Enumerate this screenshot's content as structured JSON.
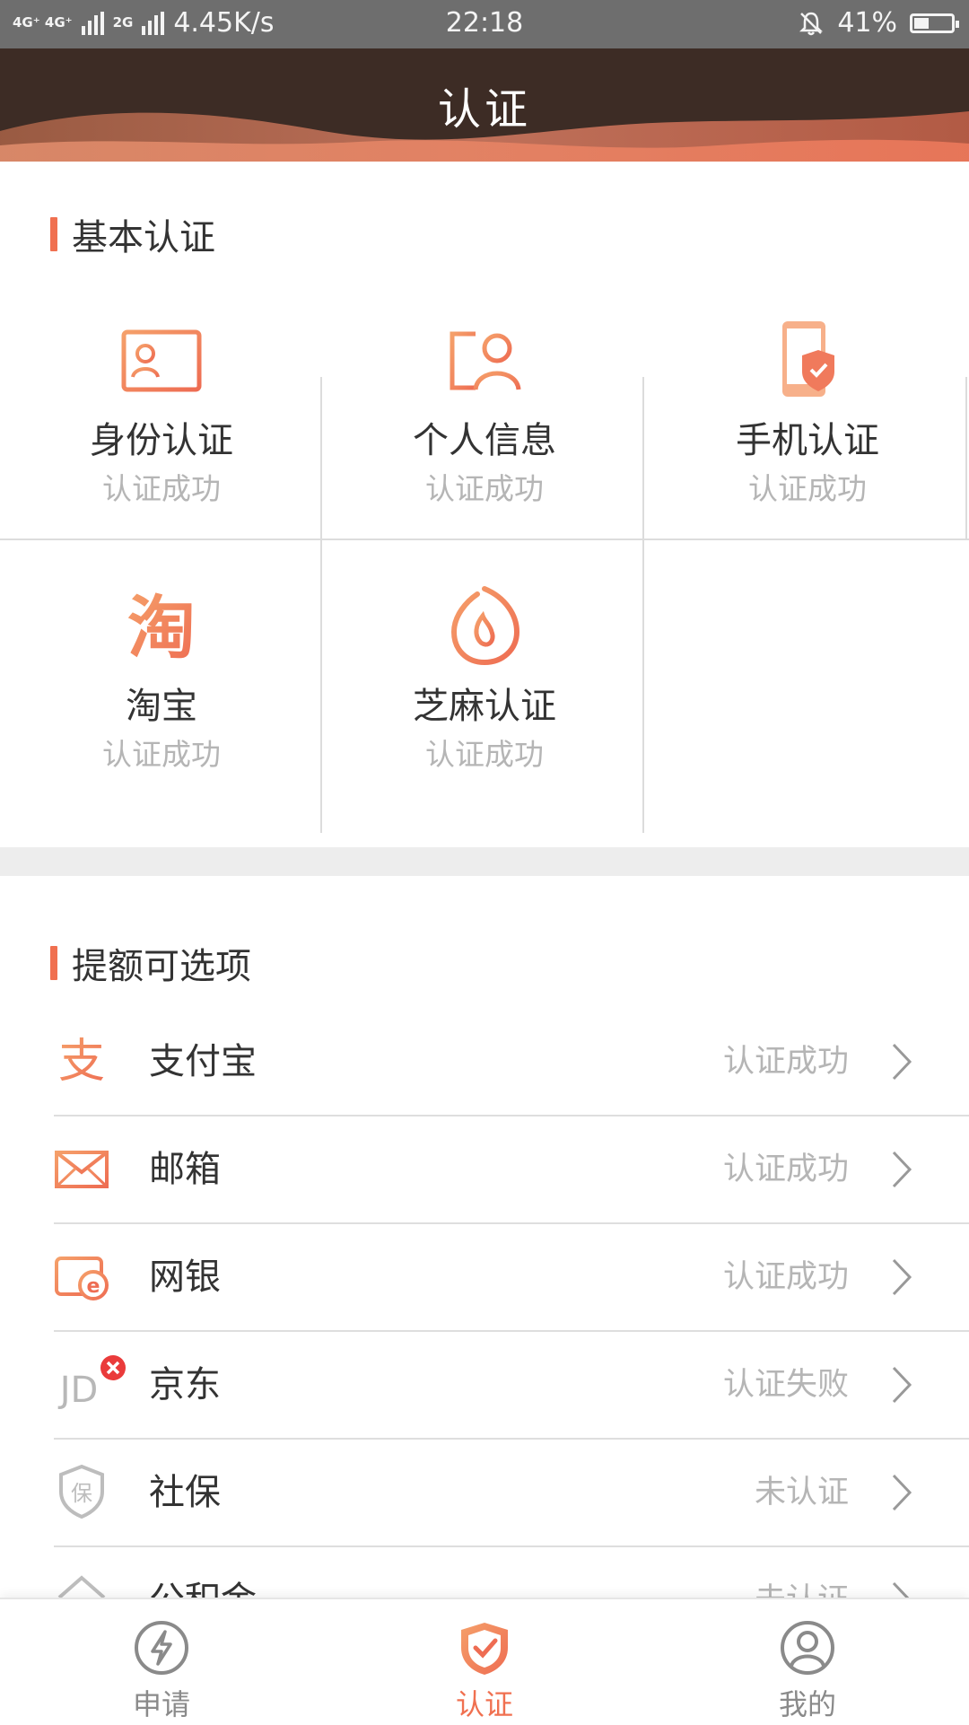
{
  "status_bar": {
    "network_left": "4G⁺ 4G⁺",
    "network_left2": "2G",
    "speed": "4.45K/s",
    "time": "22:18",
    "battery": "41%",
    "battery_level": 0.41
  },
  "header": {
    "title": "认证"
  },
  "basic": {
    "title": "基本认证",
    "items": [
      {
        "name": "身份认证",
        "status": "认证成功",
        "icon": "id-card-icon"
      },
      {
        "name": "个人信息",
        "status": "认证成功",
        "icon": "person-info-icon"
      },
      {
        "name": "手机认证",
        "status": "认证成功",
        "icon": "phone-shield-icon"
      },
      {
        "name": "淘宝",
        "status": "认证成功",
        "icon": "taobao-icon"
      },
      {
        "name": "芝麻认证",
        "status": "认证成功",
        "icon": "sesame-icon"
      }
    ]
  },
  "optional": {
    "title": "提额可选项",
    "items": [
      {
        "name": "支付宝",
        "status": "认证成功",
        "icon": "alipay-icon"
      },
      {
        "name": "邮箱",
        "status": "认证成功",
        "icon": "mail-icon"
      },
      {
        "name": "网银",
        "status": "认证成功",
        "icon": "online-bank-icon"
      },
      {
        "name": "京东",
        "status": "认证失败",
        "icon": "jd-icon"
      },
      {
        "name": "社保",
        "status": "未认证",
        "icon": "social-security-icon"
      },
      {
        "name": "公积金",
        "status": "未认证",
        "icon": "housing-fund-icon"
      }
    ]
  },
  "bottom_nav": [
    {
      "label": "申请",
      "icon": "lightning-icon"
    },
    {
      "label": "认证",
      "icon": "shield-check-icon",
      "active": true
    },
    {
      "label": "我的",
      "icon": "user-icon"
    }
  ],
  "colors": {
    "accent": "#f07050",
    "header_bg": "#3d2c25",
    "muted": "#b5b5b5"
  }
}
